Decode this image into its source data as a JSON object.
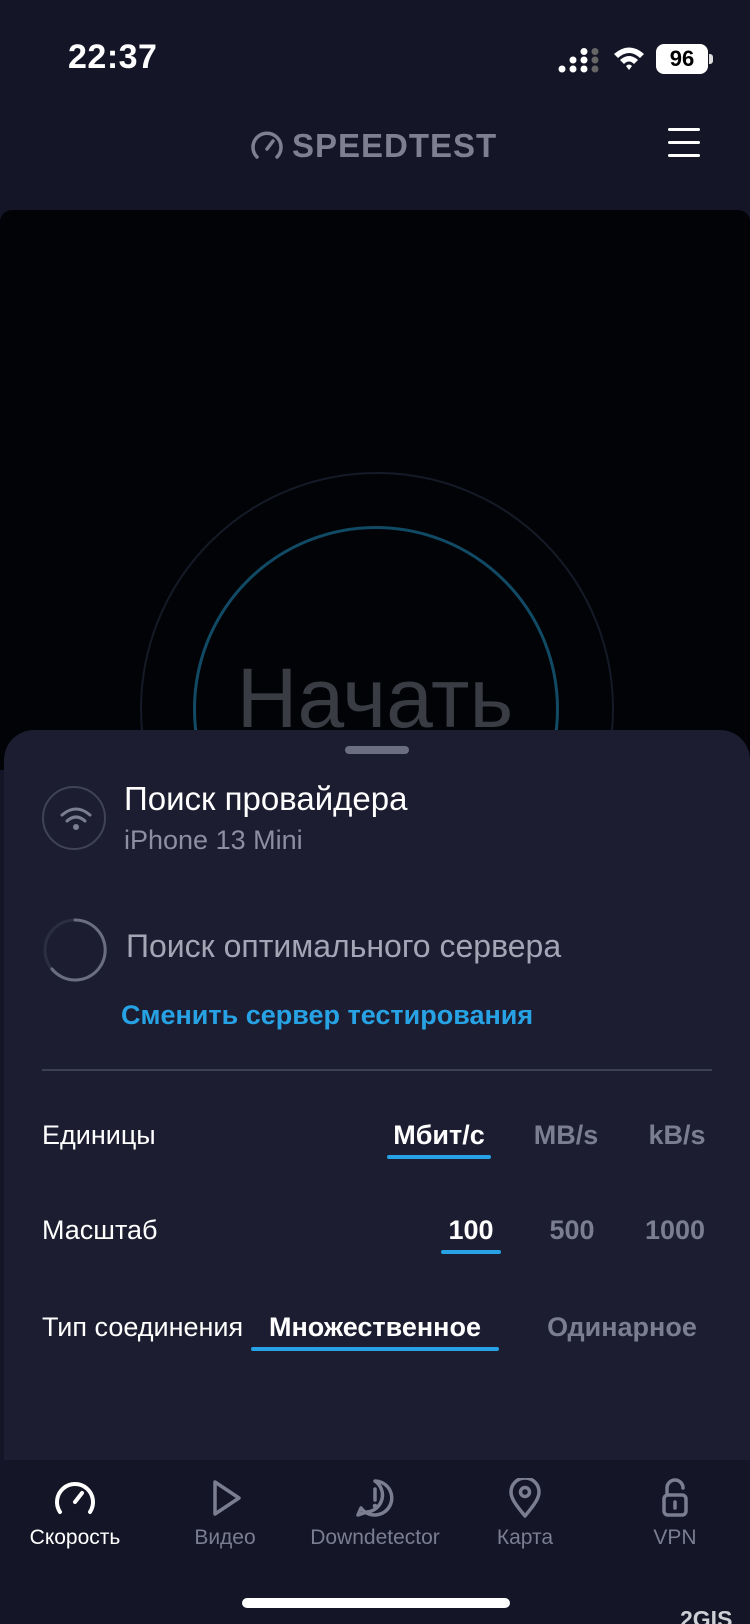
{
  "status_bar": {
    "time": "22:37",
    "battery": "96"
  },
  "header": {
    "logo_text": "SPEEDTEST",
    "logo_icon": "gauge-icon",
    "menu_icon": "hamburger-icon"
  },
  "test": {
    "start_label": "Начать"
  },
  "sheet": {
    "provider_title": "Поиск провайдера",
    "provider_sub": "iPhone 13 Mini",
    "server_text": "Поиск оптимального сервера",
    "change_server": "Сменить сервер тестирования",
    "settings": {
      "units": {
        "label": "Единицы",
        "options": [
          "Мбит/с",
          "MB/s",
          "kB/s"
        ],
        "selected": "Мбит/с"
      },
      "scale": {
        "label": "Масштаб",
        "options": [
          "100",
          "500",
          "1000"
        ],
        "selected": "100"
      },
      "connection": {
        "label": "Тип соединения",
        "options": [
          "Множественное",
          "Одинарное"
        ],
        "selected": "Множественное"
      }
    }
  },
  "tabs": [
    {
      "label": "Скорость",
      "icon": "speedometer-icon",
      "active": true
    },
    {
      "label": "Видео",
      "icon": "play-icon",
      "active": false
    },
    {
      "label": "Downdetector",
      "icon": "alert-icon",
      "active": false
    },
    {
      "label": "Карта",
      "icon": "map-pin-icon",
      "active": false
    },
    {
      "label": "VPN",
      "icon": "unlock-icon",
      "active": false
    }
  ],
  "watermark": "2GIS",
  "colors": {
    "accent": "#27a3e5",
    "background": "#141526",
    "sheet": "#1c1d30"
  }
}
